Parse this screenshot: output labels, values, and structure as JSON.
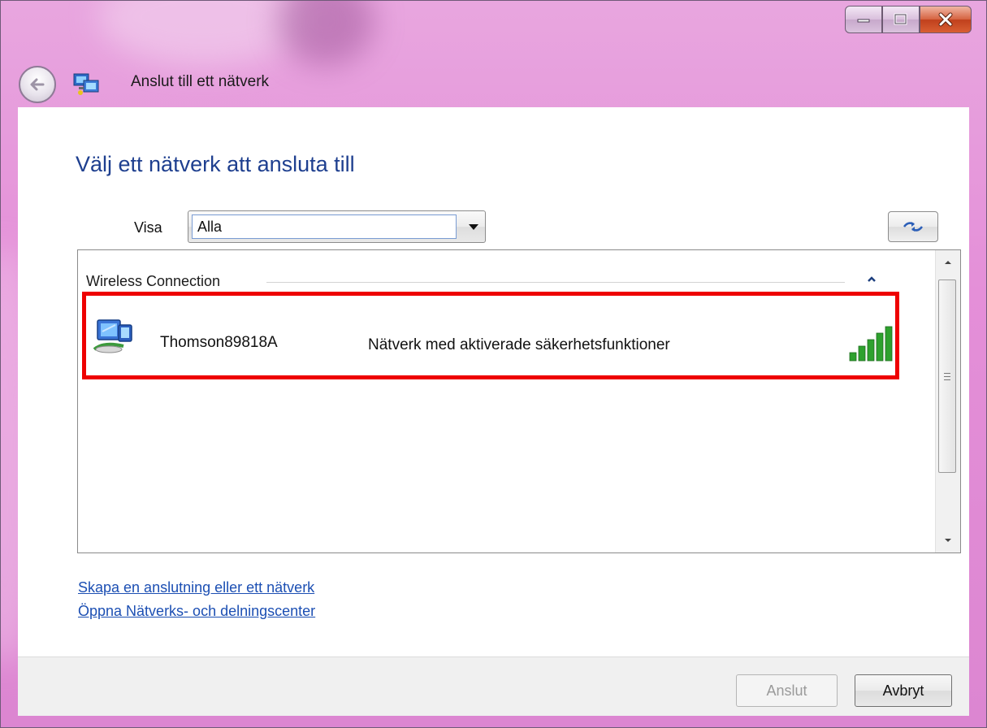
{
  "window": {
    "title": "Anslut till ett nätverk",
    "controls": {
      "minimize": "minimize",
      "maximize": "maximize",
      "close": "close"
    }
  },
  "main": {
    "heading": "Välj ett nätverk att ansluta till",
    "filter": {
      "label": "Visa",
      "selected": "Alla"
    }
  },
  "network_list": {
    "group": "Wireless Connection",
    "networks": [
      {
        "name": "Thomson89818A",
        "security": "Nätverk med aktiverade säkerhetsfunktioner",
        "signal_bars": 5,
        "signal_max": 5,
        "highlighted": true
      }
    ]
  },
  "links": {
    "create": "Skapa en anslutning eller ett nätverk",
    "center": "Öppna Nätverks- och delningscenter"
  },
  "buttons": {
    "connect": "Anslut",
    "cancel": "Avbryt"
  },
  "colors": {
    "heading": "#1e3f8f",
    "link": "#1c4fb3",
    "highlight_border": "#ee0000",
    "signal": "#2ea12e",
    "titlebar": "#e48fd8"
  }
}
